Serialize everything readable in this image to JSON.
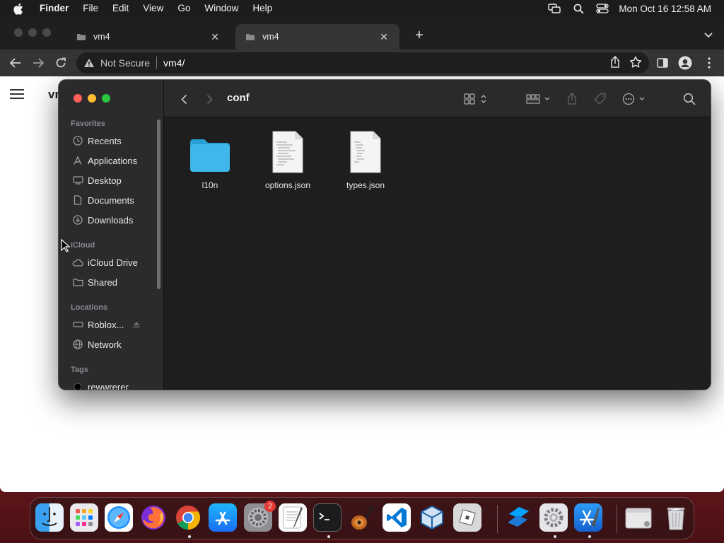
{
  "menubar": {
    "apple_icon": "apple-logo-icon",
    "app_name": "Finder",
    "menus": [
      "File",
      "Edit",
      "View",
      "Go",
      "Window",
      "Help"
    ],
    "status_icons": [
      "screen-mirroring-icon",
      "spotlight-search-icon",
      "control-center-icon"
    ],
    "clock": "Mon Oct 16  12:58 AM"
  },
  "browser": {
    "tabs": [
      {
        "title": "vm4",
        "active": false
      },
      {
        "title": "vm4",
        "active": true
      }
    ],
    "security_label": "Not Secure",
    "url": "vm4/",
    "page_title": "vm4"
  },
  "finder": {
    "title": "conf",
    "sidebar": {
      "favorites_label": "Favorites",
      "favorites": [
        {
          "label": "Recents",
          "icon": "clock-icon"
        },
        {
          "label": "Applications",
          "icon": "applications-icon"
        },
        {
          "label": "Desktop",
          "icon": "desktop-icon"
        },
        {
          "label": "Documents",
          "icon": "document-icon"
        },
        {
          "label": "Downloads",
          "icon": "download-icon"
        }
      ],
      "icloud_label": "iCloud",
      "icloud": [
        {
          "label": "iCloud Drive",
          "icon": "cloud-icon"
        },
        {
          "label": "Shared",
          "icon": "shared-folder-icon"
        }
      ],
      "locations_label": "Locations",
      "locations": [
        {
          "label": "Roblox...",
          "icon": "disk-icon"
        },
        {
          "label": "Network",
          "icon": "globe-icon"
        }
      ],
      "tags_label": "Tags",
      "tags": [
        {
          "label": "rewwrerer",
          "color": "#000000"
        }
      ]
    },
    "files": [
      {
        "name": "l10n",
        "kind": "folder"
      },
      {
        "name": "options.json",
        "kind": "document"
      },
      {
        "name": "types.json",
        "kind": "document"
      }
    ]
  },
  "dock": {
    "apps": [
      "Finder",
      "Launchpad",
      "Safari",
      "Firefox",
      "Google Chrome",
      "App Store",
      "System Settings",
      "TextEdit",
      "Terminal",
      "GarageBand",
      "Visual Studio Code",
      "VirtualBox",
      "Roblox",
      "Roblox Studio",
      "Settings",
      "Xcode",
      "Downloads",
      "Trash"
    ],
    "settings_badge": "2"
  },
  "colors": {
    "folder_blue": "#3fb7ea",
    "close_red": "#fe5f57",
    "minimize_yellow": "#febc2e",
    "zoom_green": "#28c840"
  }
}
